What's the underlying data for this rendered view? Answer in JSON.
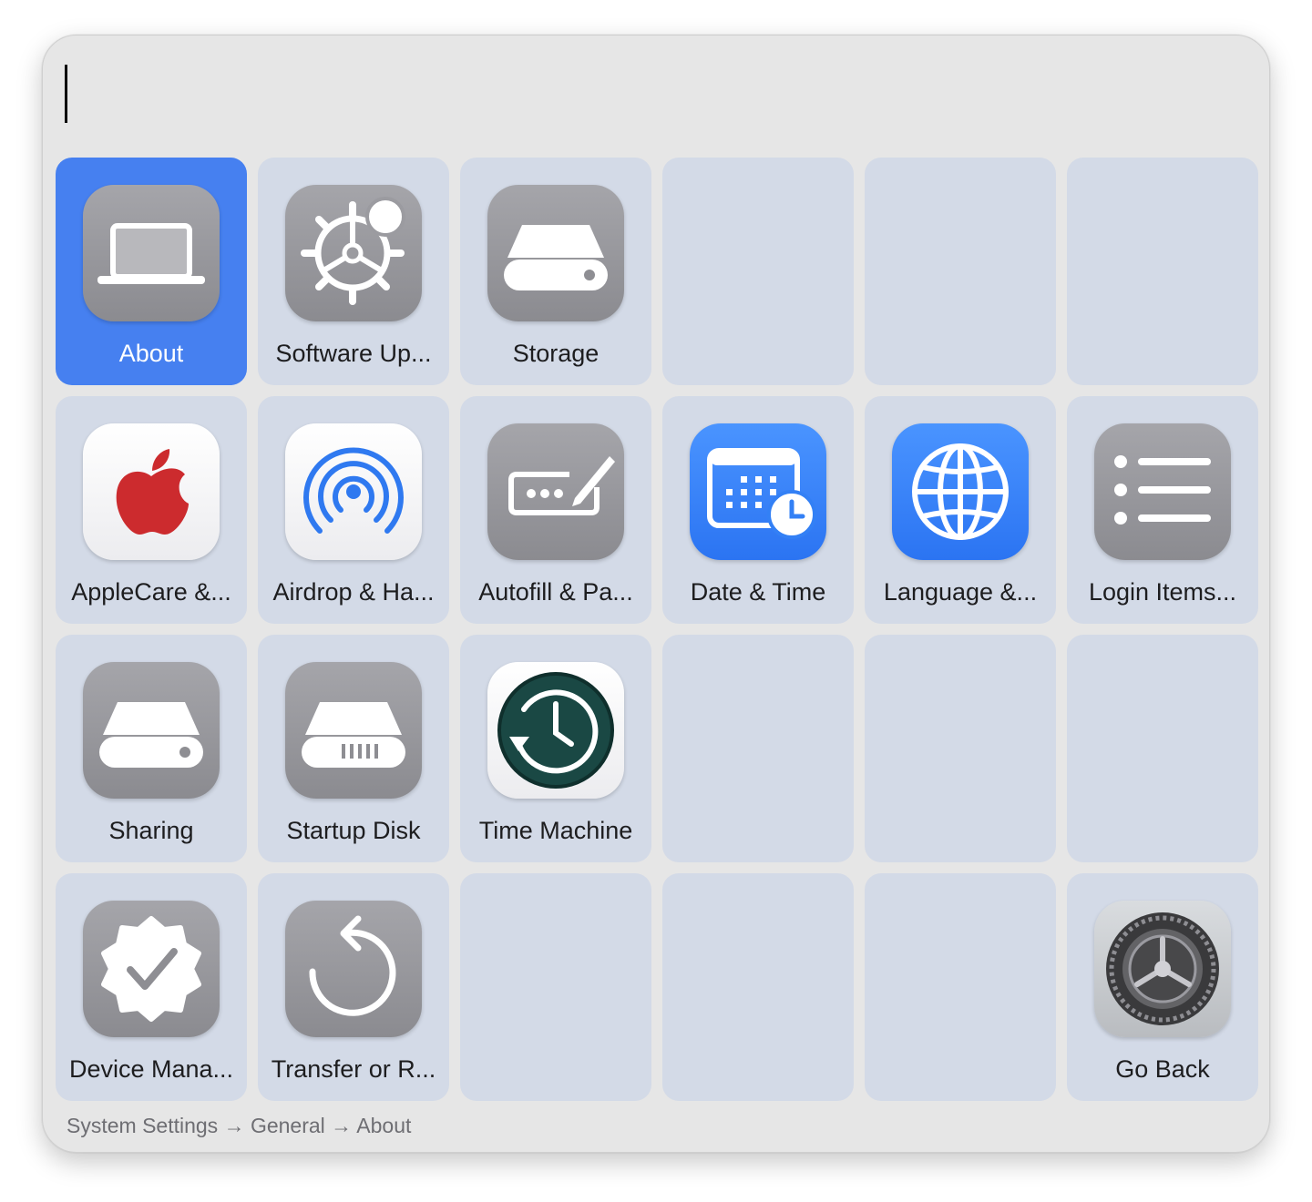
{
  "search": {
    "value": "",
    "placeholder": ""
  },
  "tiles": {
    "about": "About",
    "software_update": "Software Up...",
    "storage": "Storage",
    "applecare": "AppleCare &...",
    "airdrop": "Airdrop & Ha...",
    "autofill": "Autofill & Pa...",
    "date_time": "Date & Time",
    "language": "Language &...",
    "login_items": "Login Items...",
    "sharing": "Sharing",
    "startup_disk": "Startup Disk",
    "time_machine": "Time Machine",
    "device_management": "Device Mana...",
    "transfer_reset": "Transfer or R...",
    "go_back": "Go Back"
  },
  "selected_tile": "about",
  "breadcrumb": "System Settings → General → About",
  "colors": {
    "selected": "#4680f0",
    "tile": "#d3dae7",
    "panel": "#e6e6e6",
    "accent_blue": "#2b74f2"
  },
  "icons": {
    "about": "laptop-icon",
    "software_update": "gear-badge-icon",
    "storage": "drive-icon",
    "applecare": "apple-logo-icon",
    "airdrop": "airdrop-icon",
    "autofill": "password-keyboard-icon",
    "date_time": "calendar-clock-icon",
    "language": "globe-icon",
    "login_items": "list-icon",
    "sharing": "drive-icon",
    "startup_disk": "startup-disk-icon",
    "time_machine": "time-machine-icon",
    "device_management": "checkmark-seal-icon",
    "transfer_reset": "reset-arrow-icon",
    "go_back": "system-settings-gear-icon"
  }
}
